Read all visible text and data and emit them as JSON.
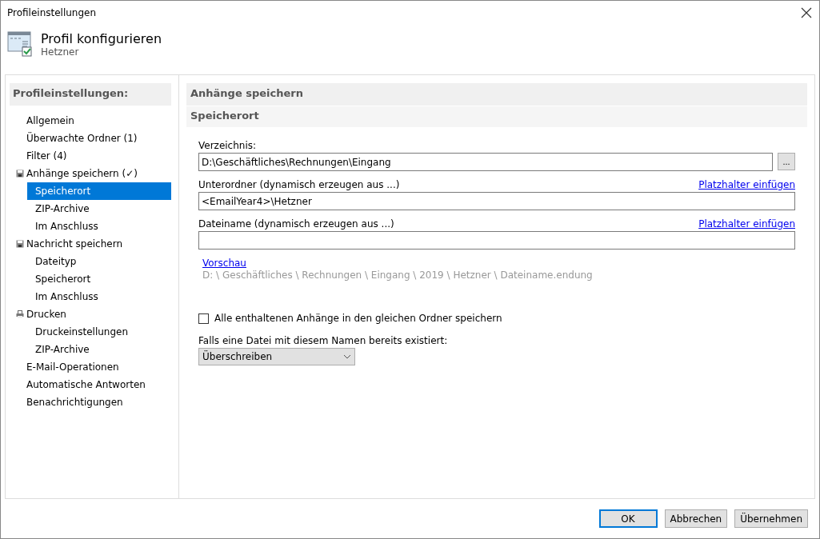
{
  "window": {
    "title": "Profileinstellungen"
  },
  "header": {
    "title": "Profil konfigurieren",
    "subtitle": "Hetzner"
  },
  "sidebar": {
    "title": "Profileinstellungen:",
    "items": [
      {
        "label": "Allgemein",
        "selected": false
      },
      {
        "label": "Überwachte Ordner (1)",
        "selected": false
      },
      {
        "label": "Filter (4)",
        "selected": false
      },
      {
        "label": "Anhänge speichern (✓)",
        "selected": false,
        "kind": "save",
        "children": [
          {
            "label": "Speicherort",
            "selected": true
          },
          {
            "label": "ZIP-Archive",
            "selected": false
          },
          {
            "label": "Im Anschluss",
            "selected": false
          }
        ]
      },
      {
        "label": "Nachricht speichern",
        "selected": false,
        "kind": "save",
        "children": [
          {
            "label": "Dateityp",
            "selected": false
          },
          {
            "label": "Speicherort",
            "selected": false
          },
          {
            "label": "Im Anschluss",
            "selected": false
          }
        ]
      },
      {
        "label": "Drucken",
        "selected": false,
        "kind": "print",
        "children": [
          {
            "label": "Druckeinstellungen",
            "selected": false
          },
          {
            "label": "ZIP-Archive",
            "selected": false
          }
        ]
      },
      {
        "label": "E-Mail-Operationen",
        "selected": false
      },
      {
        "label": "Automatische Antworten",
        "selected": false
      },
      {
        "label": "Benachrichtigungen",
        "selected": false
      }
    ]
  },
  "content": {
    "section_title": "Anhänge speichern",
    "subsection_title": "Speicherort",
    "fields": [
      {
        "label": "Verzeichnis:",
        "value": "D:\\Geschäftliches\\Rechnungen\\Eingang",
        "browse_button": "..."
      },
      {
        "label": "Unterordner (dynamisch erzeugen aus ...)",
        "value": "<EmailYear4>\\Hetzner",
        "link": "Platzhalter einfügen"
      },
      {
        "label": "Dateiname (dynamisch erzeugen aus ...)",
        "link": "Platzhalter einfügen"
      }
    ],
    "preview_link": "Vorschau",
    "preview_path": "D: \\ Geschäftliches \\ Rechnungen \\ Eingang \\ 2019 \\ Hetzner \\ Dateiname.endung",
    "checkbox": {
      "label": "Alle enthaltenen Anhänge in den gleichen Ordner speichern",
      "checked": false
    },
    "exists_label": "Falls eine Datei mit diesem Namen bereits existiert:",
    "exists_value": "Überschreiben"
  },
  "buttons": [
    {
      "label": "OK",
      "default": true
    },
    {
      "label": "Abbrechen",
      "default": false
    },
    {
      "label": "Übernehmen",
      "default": false
    }
  ]
}
